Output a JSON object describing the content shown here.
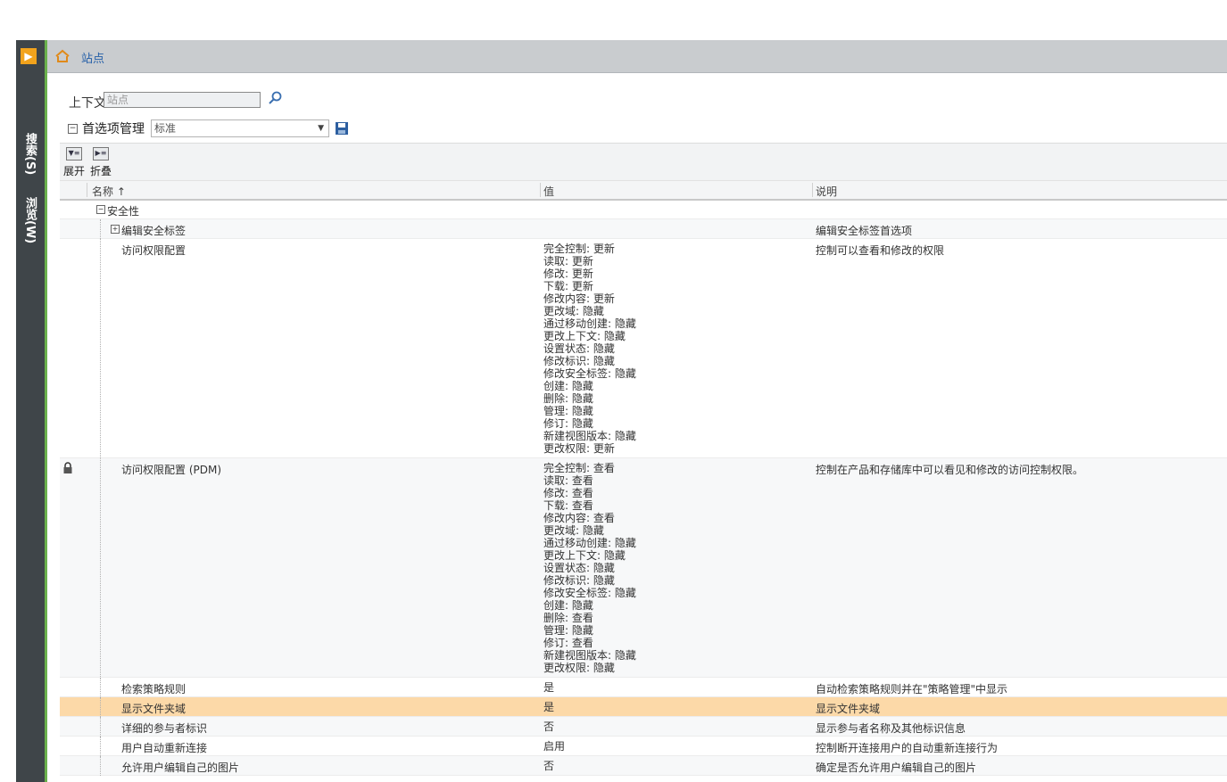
{
  "nav": {
    "search_tab": "搜索(S)",
    "browse_tab": "浏览(W)"
  },
  "header": {
    "home_label": "站点"
  },
  "context": {
    "label": "上下文",
    "value": "站点"
  },
  "preference": {
    "label": "首选项管理",
    "selected": "标准"
  },
  "toolbar": {
    "expand": "展开",
    "collapse": "折叠"
  },
  "columns": {
    "name": "名称 ↑",
    "value": "值",
    "description": "说明"
  },
  "rows": [
    {
      "name": "安全性",
      "value": "",
      "description": ""
    },
    {
      "name": "编辑安全标签",
      "value": "",
      "description": "编辑安全标签首选项"
    },
    {
      "name": "访问权限配置",
      "value": "完全控制: 更新\n读取: 更新\n修改: 更新\n下载: 更新\n修改内容: 更新\n更改域: 隐藏\n通过移动创建: 隐藏\n更改上下文: 隐藏\n设置状态: 隐藏\n修改标识: 隐藏\n修改安全标签: 隐藏\n创建: 隐藏\n删除: 隐藏\n管理: 隐藏\n修订: 隐藏\n新建视图版本: 隐藏\n更改权限: 更新",
      "description": "控制可以查看和修改的权限"
    },
    {
      "name": "访问权限配置 (PDM)",
      "value": "完全控制: 查看\n读取: 查看\n修改: 查看\n下载: 查看\n修改内容: 查看\n更改域: 隐藏\n通过移动创建: 隐藏\n更改上下文: 隐藏\n设置状态: 隐藏\n修改标识: 隐藏\n修改安全标签: 隐藏\n创建: 隐藏\n删除: 查看\n管理: 隐藏\n修订: 查看\n新建视图版本: 隐藏\n更改权限: 隐藏",
      "description": "控制在产品和存储库中可以看见和修改的访问控制权限。"
    },
    {
      "name": "检索策略规则",
      "value": "是",
      "description": "自动检索策略规则并在\"策略管理\"中显示"
    },
    {
      "name": "显示文件夹域",
      "value": "是",
      "description": "显示文件夹域"
    },
    {
      "name": "详细的参与者标识",
      "value": "否",
      "description": "显示参与者名称及其他标识信息"
    },
    {
      "name": "用户自动重新连接",
      "value": "启用",
      "description": "控制断开连接用户的自动重新连接行为"
    },
    {
      "name": "允许用户编辑自己的图片",
      "value": "否",
      "description": "确定是否允许用户编辑自己的图片"
    }
  ],
  "colors": {
    "rail": "#3f4549",
    "rail_accent": "#6ab04c",
    "toggle": "#f2a31c",
    "header_bg": "#c9cccf",
    "link": "#245fa8",
    "highlight_row": "#fcd9a8"
  },
  "icons": [
    "panel-toggle-icon",
    "home-icon",
    "search-icon",
    "save-icon",
    "expand-icon",
    "collapse-icon",
    "lock-icon",
    "tree-collapse-icon",
    "tree-expand-icon"
  ]
}
